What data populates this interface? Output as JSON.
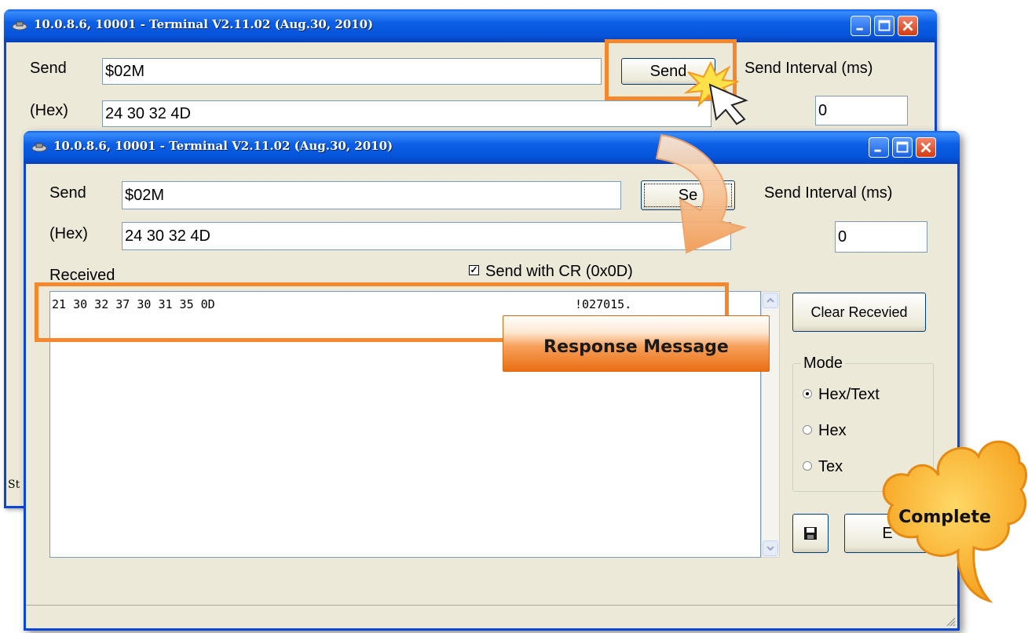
{
  "back_window": {
    "title": "10.0.8.6, 10001 - Terminal V2.11.02 (Aug.30, 2010)",
    "send_label": "Send",
    "send_value": "$02M",
    "hex_label": "(Hex)",
    "hex_value": "24 30 32 4D",
    "send_button": "Send",
    "interval_label": "Send Interval (ms)",
    "interval_value": "0",
    "status_text": "St"
  },
  "front_window": {
    "title": "10.0.8.6, 10001 - Terminal V2.11.02 (Aug.30, 2010)",
    "send_label": "Send",
    "send_value": "$02M",
    "hex_label": "(Hex)",
    "hex_value": "24 30 32 4D",
    "send_button": "Se",
    "interval_label": "Send Interval (ms)",
    "interval_value": "0",
    "cr_checkbox_label": "Send with CR (0x0D)",
    "cr_checked": true,
    "received_label": "Received",
    "received_hex": "21 30 32 37 30 31 35 0D",
    "received_text": "!027015.",
    "clear_button": "Clear Recevied",
    "mode_label": "Mode",
    "mode_options": [
      "Hex/Text",
      "Hex",
      "Tex"
    ],
    "mode_selected": "Hex/Text",
    "exit_button": "E"
  },
  "annotations": {
    "response_message": "Response Message",
    "complete": "Complete",
    "highlight_color": "#f5872c"
  }
}
